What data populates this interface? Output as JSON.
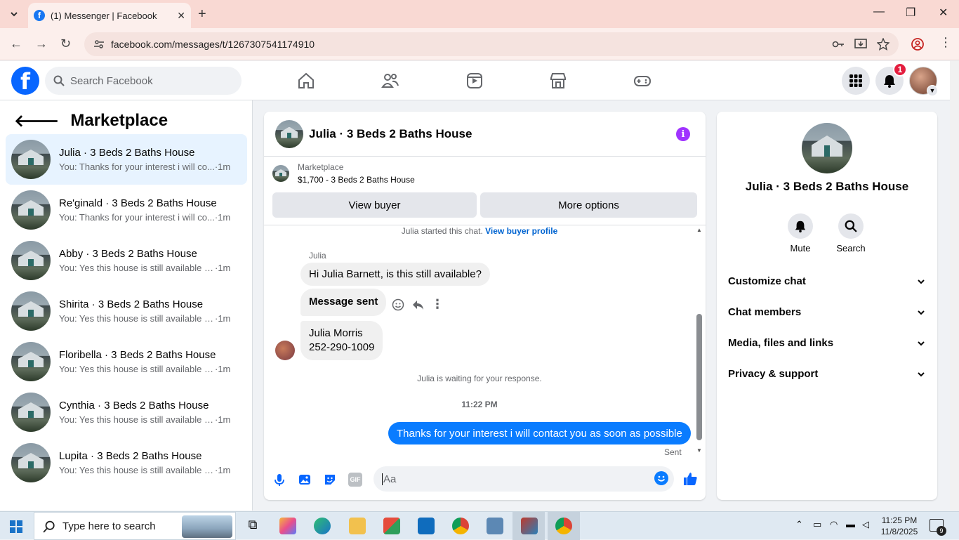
{
  "browser": {
    "tab_title": "(1) Messenger | Facebook",
    "url": "facebook.com/messages/t/1267307541174910"
  },
  "fb": {
    "search_placeholder": "Search Facebook",
    "notif_count": "1"
  },
  "sidebar": {
    "title": "Marketplace",
    "conversations": [
      {
        "name": "Julia · 3 Beds 2 Baths House",
        "last": "You: Thanks for your interest i will co...",
        "time": "·1m"
      },
      {
        "name": "Re'ginald · 3 Beds 2 Baths House",
        "last": "You: Thanks for your interest i will co...",
        "time": "·1m"
      },
      {
        "name": "Abby · 3 Beds 2 Baths House",
        "last": "You: Yes this house is still available fo...",
        "time": "·1m"
      },
      {
        "name": "Shirita · 3 Beds 2 Baths House",
        "last": "You: Yes this house is still available fo...",
        "time": "·1m"
      },
      {
        "name": "Floribella · 3 Beds 2 Baths House",
        "last": "You: Yes this house is still available fo...",
        "time": "·1m"
      },
      {
        "name": "Cynthia · 3 Beds 2 Baths House",
        "last": "You: Yes this house is still available fo...",
        "time": "·1m"
      },
      {
        "name": "Lupita · 3 Beds 2 Baths House",
        "last": "You: Yes this house is still available fo...",
        "time": "·1m"
      }
    ]
  },
  "chat": {
    "title": "Julia · 3 Beds 2 Baths House",
    "marketplace_label": "Marketplace",
    "listing": "$1,700 - 3 Beds 2 Baths House",
    "view_buyer": "View buyer",
    "more_options": "More options",
    "started_text": "Julia started this chat.",
    "view_profile": "View buyer profile",
    "sender": "Julia",
    "msg1": "Hi Julia Barnett, is this still available?",
    "msg2": "Message sent",
    "msg3_line1": "Julia Morris",
    "msg3_line2": "252-290-1009",
    "waiting": "Julia is waiting for your response.",
    "time": "11:22 PM",
    "outgoing": "Thanks for your interest i will contact you as soon as possible",
    "sent": "Sent",
    "composer_placeholder": "Aa",
    "gif_label": "GIF"
  },
  "info": {
    "title": "Julia · 3 Beds 2 Baths House",
    "mute": "Mute",
    "search": "Search",
    "sections": [
      "Customize chat",
      "Chat members",
      "Media, files and links",
      "Privacy & support"
    ]
  },
  "taskbar": {
    "search_placeholder": "Type here to search",
    "time": "11:25 PM",
    "date": "11/8/2025",
    "notif_count": "9"
  },
  "colors": {
    "fb_blue": "#0866ff",
    "bubble_blue": "#0a7cff",
    "info_purple": "#a033ff",
    "badge_red": "#e41e3f"
  }
}
